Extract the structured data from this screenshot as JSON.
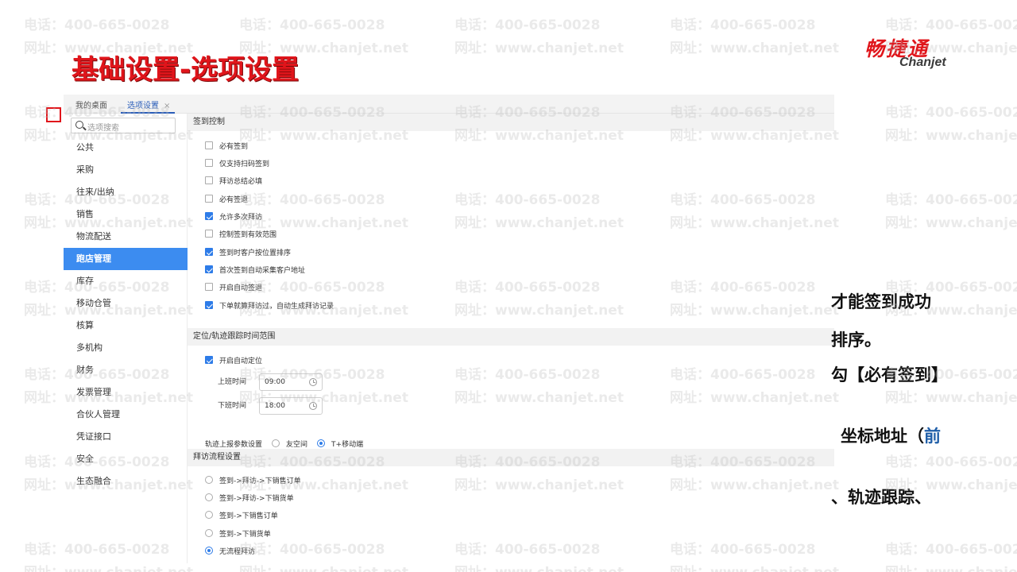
{
  "slide": {
    "title": "基础设置-选项设置",
    "logo_cn": "畅捷通",
    "logo_en": "Chanjet"
  },
  "watermark": {
    "phone": "电话：400-665-0028",
    "site": "网址：www.chanjet.net"
  },
  "tabs": {
    "home": "我的桌面",
    "active": "选项设置",
    "close": "×"
  },
  "sidebar": {
    "search_placeholder": "选项搜索",
    "items": [
      {
        "label": "公共"
      },
      {
        "label": "采购"
      },
      {
        "label": "往来/出纳"
      },
      {
        "label": "销售"
      },
      {
        "label": "物流配送"
      },
      {
        "label": "跑店管理",
        "active": true
      },
      {
        "label": "库存"
      },
      {
        "label": "移动仓管"
      },
      {
        "label": "核算"
      },
      {
        "label": "多机构"
      },
      {
        "label": "财务"
      },
      {
        "label": "发票管理"
      },
      {
        "label": "合伙人管理"
      },
      {
        "label": "凭证接口"
      },
      {
        "label": "安全"
      },
      {
        "label": "生态融合"
      }
    ]
  },
  "checkin": {
    "title": "签到控制",
    "options": [
      {
        "label": "必有签到",
        "checked": false
      },
      {
        "label": "仅支持扫码签到",
        "checked": false
      },
      {
        "label": "拜访总结必填",
        "checked": false
      },
      {
        "label": "必有签退",
        "checked": false
      },
      {
        "label": "允许多次拜访",
        "checked": true
      },
      {
        "label": "控制签到有效范围",
        "checked": false
      },
      {
        "label": "签到时客户按位置排序",
        "checked": true
      },
      {
        "label": "首次签到自动采集客户地址",
        "checked": true
      },
      {
        "label": "开启自动签退",
        "checked": false
      },
      {
        "label": "下单就算拜访过，自动生成拜访记录",
        "checked": true
      }
    ]
  },
  "location": {
    "title": "定位/轨迹跟踪时间范围",
    "auto_locate": {
      "label": "开启自动定位",
      "checked": true
    },
    "start": {
      "label": "上班时间",
      "value": "09:00"
    },
    "end": {
      "label": "下班时间",
      "value": "18:00"
    },
    "track_label": "轨迹上报参数设置",
    "track_options": [
      {
        "label": "友空间",
        "selected": false
      },
      {
        "label": "T+移动端",
        "selected": true
      }
    ]
  },
  "flow": {
    "title": "拜访流程设置",
    "options": [
      {
        "label": "签到->拜访->下销售订单",
        "selected": false
      },
      {
        "label": "签到->拜访->下销货单",
        "selected": false
      },
      {
        "label": "签到->下销售订单",
        "selected": false
      },
      {
        "label": "签到->下销货单",
        "selected": false
      },
      {
        "label": "无流程拜访",
        "selected": true
      }
    ]
  },
  "overlay_text": {
    "line1": "才能签到成功",
    "line2": "排序。",
    "line3": "勾【必有签到】",
    "line4a": "坐标地址（",
    "line4b": "前",
    "line5": "、轨迹跟踪、"
  },
  "colors": {
    "title_red": "#e0151b",
    "active_menu": "#3c8cf0",
    "checkbox_blue": "#2e7ce8",
    "tab_blue": "#2a5db8",
    "section_bg": "#f2f2f2"
  }
}
